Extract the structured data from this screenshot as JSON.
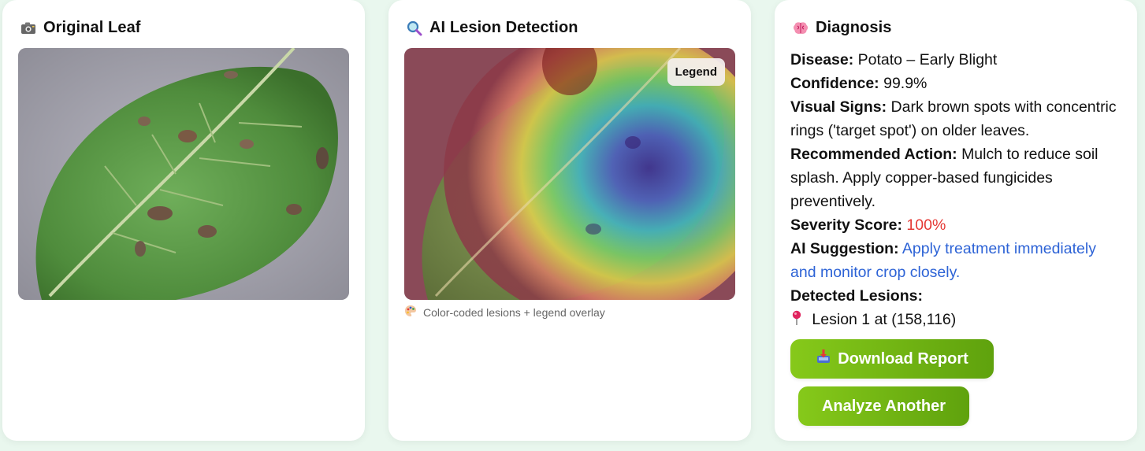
{
  "original": {
    "title": "Original Leaf",
    "icon": "camera-icon"
  },
  "detection": {
    "title": "AI Lesion Detection",
    "icon": "magnifier-icon",
    "legend_label": "Legend",
    "caption": "Color-coded lesions + legend overlay",
    "caption_icon": "palette-icon"
  },
  "diagnosis": {
    "title": "Diagnosis",
    "icon": "brain-icon",
    "disease_label": "Disease:",
    "disease_value": "Potato – Early Blight",
    "confidence_label": "Confidence:",
    "confidence_value": "99.9%",
    "signs_label": "Visual Signs:",
    "signs_value": "Dark brown spots with concentric rings ('target spot') on older leaves.",
    "action_label": "Recommended Action:",
    "action_value": "Mulch to reduce soil splash. Apply copper-based fungicides preventively.",
    "severity_label": "Severity Score:",
    "severity_value": "100%",
    "suggestion_label": "AI Suggestion:",
    "suggestion_value": "Apply treatment immediately and monitor crop closely.",
    "lesions_label": "Detected Lesions:",
    "lesions": [
      {
        "text": "Lesion 1 at (158,116)"
      }
    ],
    "colors": {
      "severity": "#e53935",
      "suggestion": "#2d63d6",
      "button_start": "#86c91a",
      "button_end": "#5fa20d"
    }
  },
  "actions": {
    "download_label": "Download Report",
    "download_icon": "download-tray-icon",
    "analyze_label": "Analyze Another"
  }
}
